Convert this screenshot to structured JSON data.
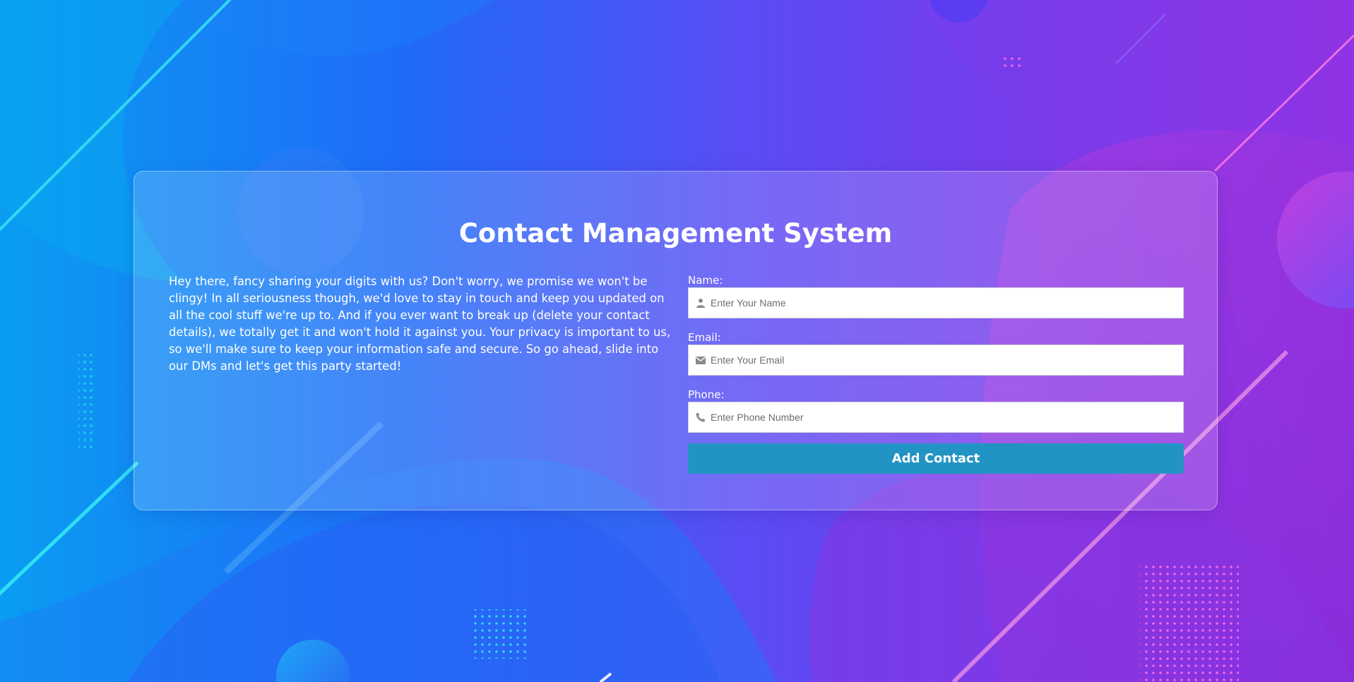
{
  "page": {
    "title": "Contact Management System",
    "intro": "Hey there, fancy sharing your digits with us? Don't worry, we promise we won't be clingy! In all seriousness though, we'd love to stay in touch and keep you updated on all the cool stuff we're up to. And if you ever want to break up (delete your contact details), we totally get it and won't hold it against you. Your privacy is important to us, so we'll make sure to keep your information safe and secure. So go ahead, slide into our DMs and let's get this party started!"
  },
  "form": {
    "name": {
      "label": "Name:",
      "placeholder": "Enter Your Name",
      "value": "",
      "icon": "user-icon"
    },
    "email": {
      "label": "Email:",
      "placeholder": "Enter Your Email",
      "value": "",
      "icon": "envelope-icon"
    },
    "phone": {
      "label": "Phone:",
      "placeholder": "Enter Phone Number",
      "value": "",
      "icon": "phone-icon"
    },
    "submit_label": "Add Contact"
  },
  "colors": {
    "button": "#2294c3",
    "text": "#ffffff",
    "gradient_start": "#0a9df2",
    "gradient_end": "#9a2fe0"
  }
}
